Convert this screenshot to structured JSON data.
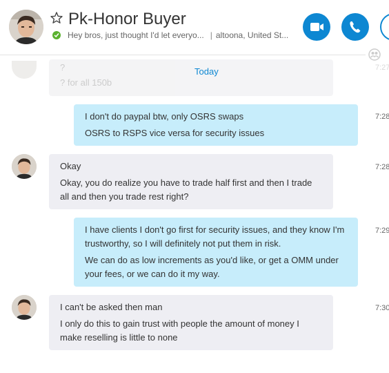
{
  "header": {
    "contact_name": "Pk-Honor Buyer",
    "mood_message": "Hey bros, just thought I'd let everyo...",
    "separator": "|",
    "location": "altoona, United St...",
    "status": "online",
    "buttons": {
      "video_call": "video-camera-icon",
      "audio_call": "phone-icon",
      "add_people": "add-person-icon"
    }
  },
  "conversation": {
    "date_separator": "Today",
    "faded_message": {
      "line1": "?",
      "line2": "? for all 150b",
      "time": "7:27"
    },
    "messages": [
      {
        "direction": "outgoing",
        "paragraphs": [
          "I don't do paypal btw, only OSRS swaps",
          "OSRS to RSPS vice versa for security issues"
        ],
        "time": "7:28"
      },
      {
        "direction": "incoming",
        "paragraphs": [
          "Okay",
          "Okay, you do realize you have to trade half first and then I trade all and then you trade rest right?"
        ],
        "time": "7:28"
      },
      {
        "direction": "outgoing",
        "paragraphs": [
          "I have clients I don't go first for security issues, and they know I'm trustworthy, so I will definitely not put them in risk.",
          "We can do as low increments as you'd like, or get a OMM under your fees, or we can do it my way."
        ],
        "time": "7:29"
      },
      {
        "direction": "incoming",
        "paragraphs": [
          "I can't be asked then man",
          "I only do this to gain trust with people the amount of money I make reselling is little to none"
        ],
        "time": "7:30"
      }
    ]
  },
  "colors": {
    "accent": "#0d87d2",
    "online": "#5bb12f",
    "incoming_bubble": "#eeeef3",
    "outgoing_bubble": "#c7edfb"
  }
}
